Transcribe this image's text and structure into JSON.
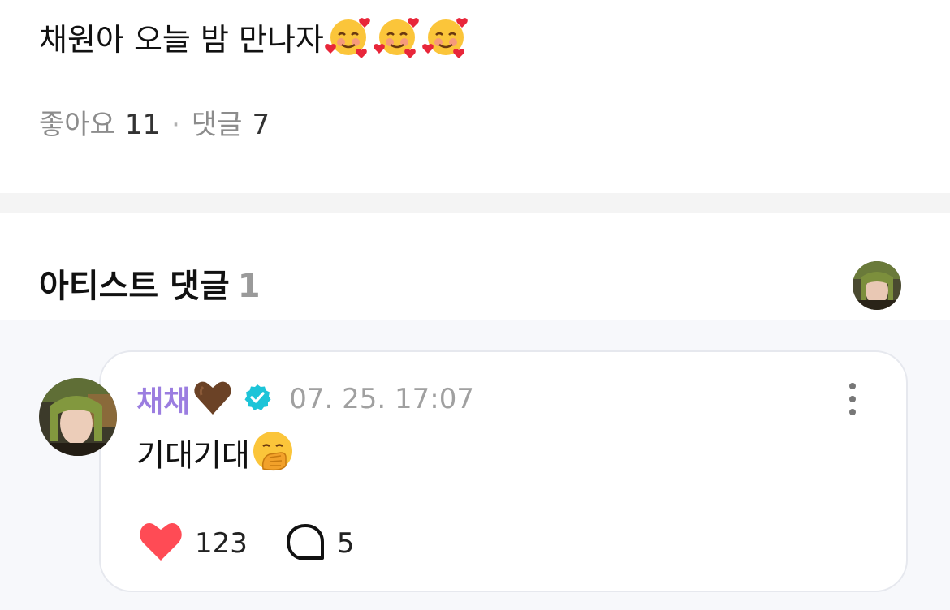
{
  "post": {
    "text": "채원아 오늘 밤 만나자"
  },
  "stats": {
    "likes_label": "좋아요",
    "likes_count": "11",
    "separator": "·",
    "comments_label": "댓글",
    "comments_count": "7"
  },
  "artist_comments": {
    "title": "아티스트 댓글",
    "count": "1"
  },
  "comment": {
    "author": "채채",
    "timestamp": "07. 25. 17:07",
    "text": "기대기대",
    "likes": "123",
    "replies": "5"
  },
  "colors": {
    "author_name": "#9b7de0",
    "verified_badge": "#1cc4d8",
    "heart": "#ff4b55"
  },
  "icons": [
    "smiling-face-with-hearts-emoji",
    "brown-heart-emoji",
    "verified-badge-icon",
    "face-with-hand-over-mouth-emoji",
    "more-vertical-icon",
    "heart-icon",
    "speech-bubble-icon"
  ]
}
